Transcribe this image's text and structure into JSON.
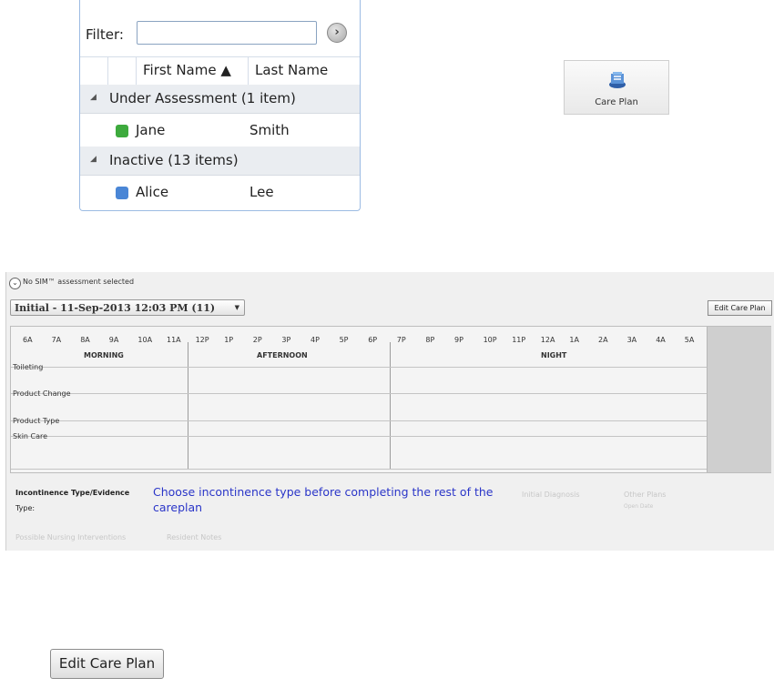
{
  "patient_list": {
    "filter_label": "Filter:",
    "filter_value": "",
    "go_icon": "chevron-right-icon",
    "columns": [
      "First Name ▲",
      "Last Name"
    ],
    "groups": [
      {
        "label": "Under Assessment (1 item)",
        "rows": [
          {
            "first": "Jane",
            "last": "Smith",
            "color": "#3daa3d"
          }
        ]
      },
      {
        "label": "Inactive (13 items)",
        "rows": [
          {
            "first": "Alice",
            "last": "Lee",
            "color": "#4a86d6"
          }
        ]
      }
    ]
  },
  "toolbar": {
    "care_plan_label": "Care Plan",
    "care_plan_icon": "care-plan-icon"
  },
  "care_plan": {
    "sim_status": "No SIM™ assessment selected",
    "assessment_select": "Initial - 11-Sep-2013 12:03 PM (11)",
    "edit_button": "Edit Care Plan",
    "hours": [
      "6A",
      "7A",
      "8A",
      "9A",
      "10A",
      "11A",
      "12P",
      "1P",
      "2P",
      "3P",
      "4P",
      "5P",
      "6P",
      "7P",
      "8P",
      "9P",
      "10P",
      "11P",
      "12A",
      "1A",
      "2A",
      "3A",
      "4A",
      "5A"
    ],
    "periods": [
      "MORNING",
      "AFTERNOON",
      "NIGHT"
    ],
    "rows": [
      "Toileting",
      "Product Change",
      "Product Type",
      "Skin Care"
    ],
    "incontinence_label": "Incontinence Type/Evidence",
    "type_label": "Type:",
    "incontinence_message": "Choose incontinence type before completing the rest of the careplan",
    "faded_labels": [
      "Initial Diagnosis",
      "Other Plans",
      "Open Date",
      "Possible Nursing Interventions",
      "Resident Notes"
    ]
  },
  "edit_care_plan_button": "Edit Care Plan"
}
